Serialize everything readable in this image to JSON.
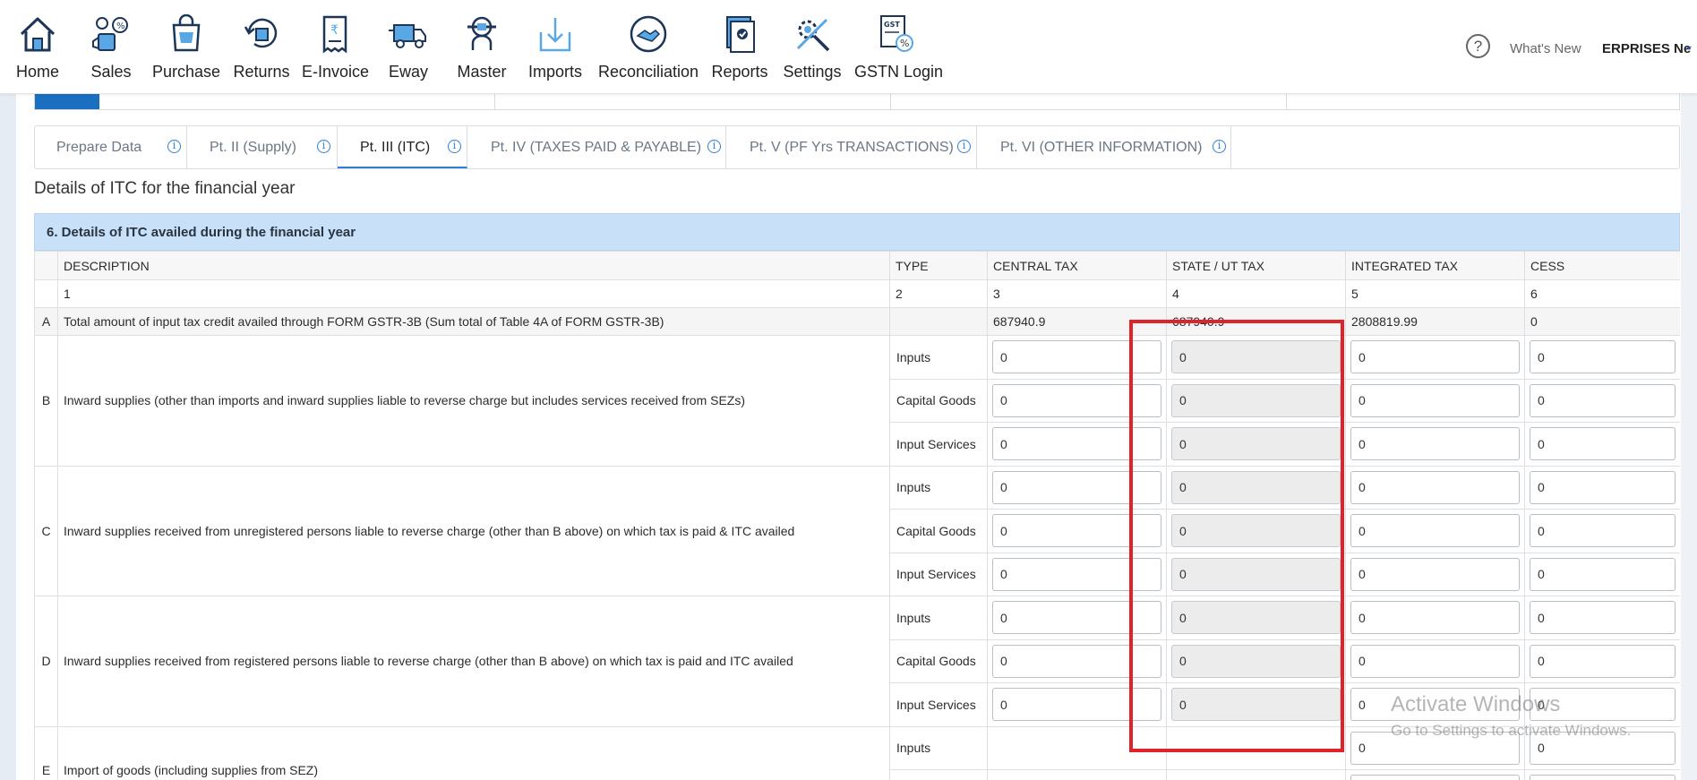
{
  "nav": {
    "items": [
      {
        "label": "Home",
        "icon": "home-icon"
      },
      {
        "label": "Sales",
        "icon": "sales-icon"
      },
      {
        "label": "Purchase",
        "icon": "purchase-icon"
      },
      {
        "label": "Returns",
        "icon": "returns-icon"
      },
      {
        "label": "E-Invoice",
        "icon": "einvoice-icon"
      },
      {
        "label": "Eway",
        "icon": "truck-icon"
      },
      {
        "label": "Master",
        "icon": "master-icon"
      },
      {
        "label": "Imports",
        "icon": "download-icon"
      },
      {
        "label": "Reconciliation",
        "icon": "handshake-icon"
      },
      {
        "label": "Reports",
        "icon": "reports-icon"
      },
      {
        "label": "Settings",
        "icon": "settings-icon"
      },
      {
        "label": "GSTN Login",
        "icon": "gst-icon"
      }
    ],
    "help": "?",
    "whats_new": "What's New",
    "company": "ERPRISES Ne"
  },
  "tabs": [
    {
      "label": "Prepare Data",
      "info": "i"
    },
    {
      "label": "Pt. II (Supply)",
      "info": "i"
    },
    {
      "label": "Pt. III (ITC)",
      "info": "i",
      "active": true
    },
    {
      "label": "Pt. IV (TAXES PAID & PAYABLE)",
      "info": "i"
    },
    {
      "label": "Pt. V (PF Yrs TRANSACTIONS)",
      "info": "i"
    },
    {
      "label": "Pt. VI (OTHER INFORMATION)",
      "info": "i"
    }
  ],
  "section_title": "Details of ITC for the financial year",
  "table": {
    "heading": "6. Details of ITC availed during the financial year",
    "columns": [
      "DESCRIPTION",
      "TYPE",
      "CENTRAL TAX",
      "STATE / UT TAX",
      "INTEGRATED TAX",
      "CESS"
    ],
    "col_nums": [
      "1",
      "2",
      "3",
      "4",
      "5",
      "6"
    ],
    "rowA": {
      "letter": "A",
      "desc": "Total amount of input tax credit availed through FORM GSTR-3B (Sum total of Table 4A of FORM GSTR-3B)",
      "central": "687940.9",
      "state": "687940.9",
      "integrated": "2808819.99",
      "cess": "0"
    },
    "rowB": {
      "letter": "B",
      "desc": "Inward supplies (other than imports and inward supplies liable to reverse charge but includes services received from SEZs)",
      "types": [
        "Inputs",
        "Capital Goods",
        "Input Services"
      ]
    },
    "rowC": {
      "letter": "C",
      "desc": "Inward supplies received from unregistered persons liable to reverse charge (other than B above) on which tax is paid & ITC availed",
      "types": [
        "Inputs",
        "Capital Goods",
        "Input Services"
      ]
    },
    "rowD": {
      "letter": "D",
      "desc": "Inward supplies received from registered persons liable to reverse charge (other than B above) on which tax is paid and ITC availed",
      "types": [
        "Inputs",
        "Capital Goods",
        "Input Services"
      ]
    },
    "rowE": {
      "letter": "E",
      "desc": "Import of goods (including supplies from SEZ)",
      "types": [
        "Inputs"
      ]
    },
    "zero": "0"
  },
  "watermark": {
    "line1": "Activate Windows",
    "line2": "Go to Settings to activate Windows."
  },
  "colors": {
    "accent": "#2f7fd6",
    "header_bg": "#c8e1f8",
    "highlight": "#e0232b"
  }
}
